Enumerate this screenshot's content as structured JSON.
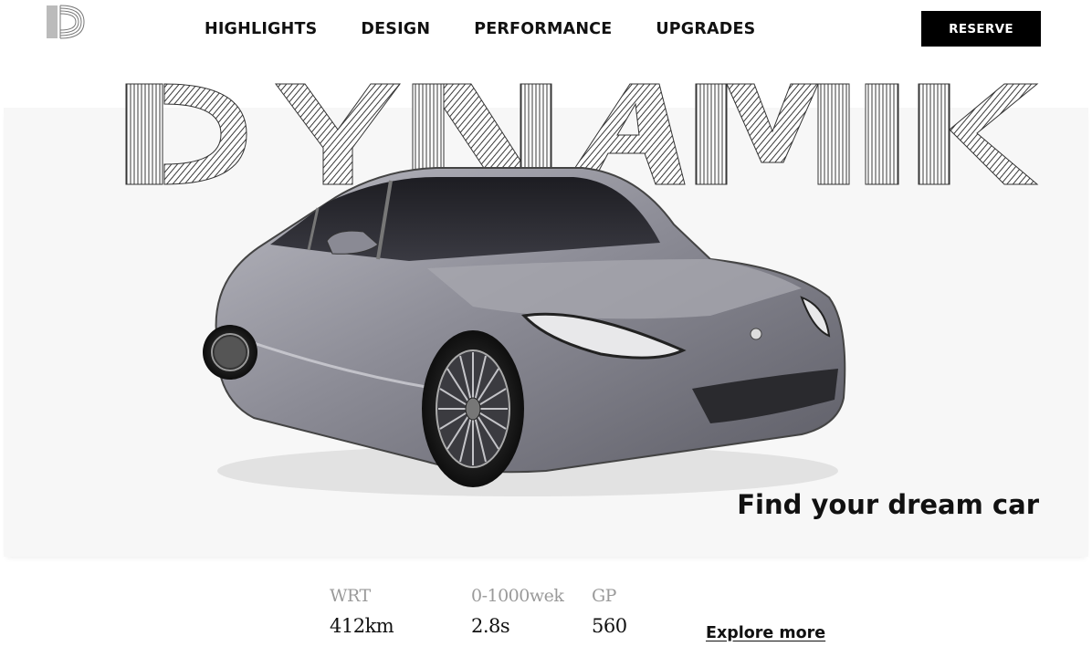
{
  "brand": {
    "logo_text": "D",
    "wordmark": "DYNAMIK"
  },
  "nav": {
    "items": [
      {
        "label": "HIGHLIGHTS"
      },
      {
        "label": "DESIGN"
      },
      {
        "label": "PERFORMANCE"
      },
      {
        "label": "UPGRADES"
      }
    ]
  },
  "header": {
    "reserve_label": "RESERVE"
  },
  "hero": {
    "tagline": "Find your dream car",
    "image_alt": "silver-hatchback-car"
  },
  "stats": [
    {
      "label": "WRT",
      "value": "412km"
    },
    {
      "label": "0-1000wek",
      "value": "2.8s"
    },
    {
      "label": "GP",
      "value": "560"
    }
  ],
  "cta": {
    "explore_label": "Explore more"
  },
  "colors": {
    "accent": "#000000",
    "hero_background": "#f7f7f7",
    "muted_text": "#9a9a9a"
  }
}
